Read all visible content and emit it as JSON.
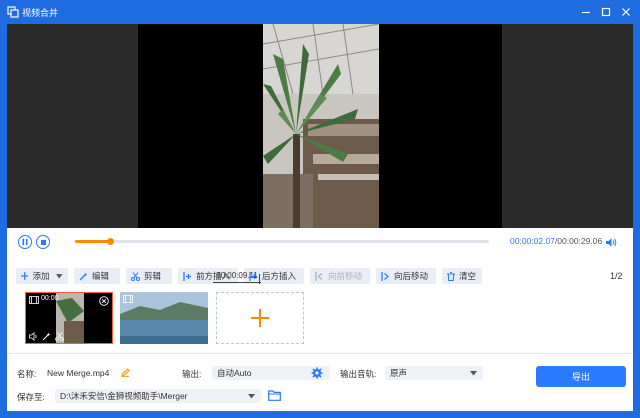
{
  "window": {
    "title": "视频合并",
    "minimize_label": "minimize",
    "maximize_label": "maximize",
    "close_label": "close"
  },
  "player": {
    "current_time": "00:00:02.07",
    "separator": "/",
    "total_time": "00:00:29.06",
    "progress": 0.085,
    "hover_time": "00:00:09.11"
  },
  "toolbar": {
    "items": [
      {
        "label": "添加",
        "icon": "plus-icon",
        "enabled": true,
        "has_dropdown": true
      },
      {
        "label": "编辑",
        "icon": "magic-wand-icon",
        "enabled": true
      },
      {
        "label": "剪辑",
        "icon": "scissors-icon",
        "enabled": true
      },
      {
        "label": "前方插入",
        "icon": "insert-before-icon",
        "enabled": true
      },
      {
        "label": "后方插入",
        "icon": "insert-after-icon",
        "enabled": true
      },
      {
        "label": "向前移动",
        "icon": "move-forward-icon",
        "enabled": false
      },
      {
        "label": "向后移动",
        "icon": "move-backward-icon",
        "enabled": true
      },
      {
        "label": "清空",
        "icon": "trash-icon",
        "enabled": true
      }
    ],
    "page_indicator": "1/2"
  },
  "clips": {
    "items": [
      {
        "duration": "00:00",
        "selected": true
      },
      {
        "duration": "",
        "selected": false
      }
    ],
    "add_icon": "plus-icon"
  },
  "output": {
    "name_label": "名称:",
    "name_value": "New Merge.mp4",
    "format_label": "输出:",
    "format_value": "自动Auto",
    "audio_label": "输出音轨:",
    "audio_value": "原声",
    "save_label": "保存至:",
    "save_path": "D:\\沐禾安信\\金狮视频助手\\Merger",
    "export_label": "导出"
  },
  "colors": {
    "accent": "#2a7bff",
    "progress": "#ff8a00",
    "titlebar": "#1f6ce0",
    "selected_clip_border": "#ff5a3c"
  }
}
